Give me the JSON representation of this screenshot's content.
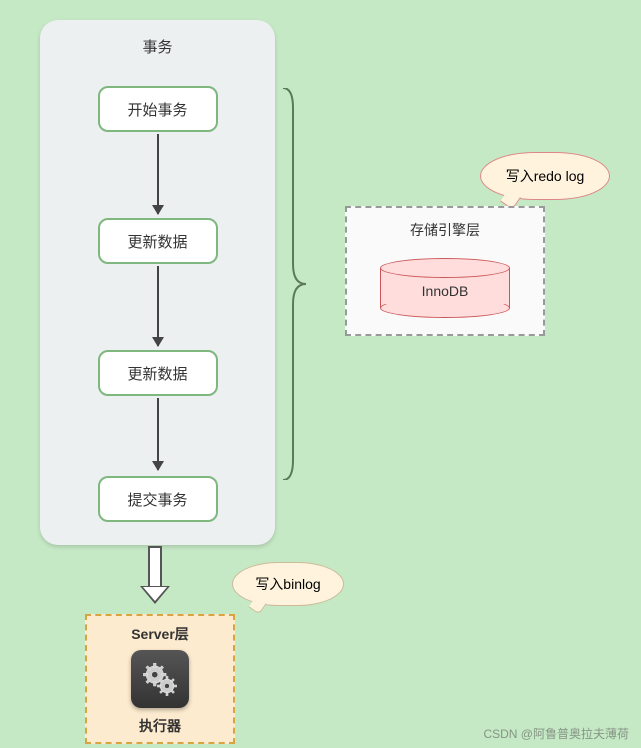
{
  "transaction": {
    "title": "事务",
    "steps": [
      "开始事务",
      "更新数据",
      "更新数据",
      "提交事务"
    ]
  },
  "storage": {
    "title": "存储引擎层",
    "engine": "InnoDB"
  },
  "callouts": {
    "redo": "写入redo log",
    "binlog": "写入binlog"
  },
  "server": {
    "title": "Server层",
    "executor": "执行器"
  },
  "watermark": "CSDN @阿鲁普奥拉夫薄荷"
}
